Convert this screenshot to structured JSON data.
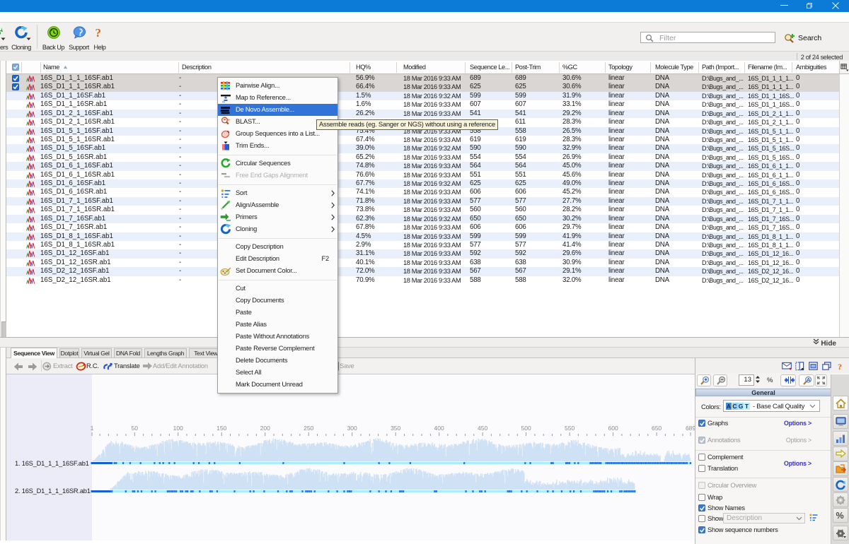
{
  "window": {
    "titlebar_color": "#0c7bd8",
    "controls": [
      "minimize",
      "restore",
      "close"
    ]
  },
  "toolbar": {
    "items": [
      {
        "id": "primers-partial",
        "label": "ers",
        "icon": "primers-icon",
        "dropdown": true
      },
      {
        "id": "cloning",
        "label": "Cloning",
        "icon": "cloning-icon",
        "dropdown": true
      },
      {
        "id": "backup",
        "label": "Back Up",
        "icon": "backup-icon"
      },
      {
        "id": "support",
        "label": "Support",
        "icon": "support-icon"
      },
      {
        "id": "help",
        "label": "Help",
        "icon": "help-icon"
      }
    ],
    "filter_placeholder": "Filter",
    "search_label": "Search"
  },
  "statusbar": {
    "selection": "2 of 24 selected"
  },
  "table": {
    "columns": [
      "Name",
      "Description",
      "HQ%",
      "Modified",
      "Sequence Le...",
      "Post-Trim",
      "%GC",
      "Topology",
      "Molecule Type",
      "Path (Import...",
      "Filename (Im...",
      "Ambiguities"
    ],
    "sort_column": "Name",
    "rows": [
      {
        "sel": true,
        "name": "16S_D1_1_1_16SF.ab1",
        "desc": "-",
        "hq": "56.9%",
        "mod": "18 Mar 2016 9:33 AM",
        "len": "689",
        "post": "689",
        "gc": "30.6%",
        "topo": "linear",
        "mol": "DNA",
        "path": "D:\\Bugs_and_...",
        "file": "16S_D1_1_1_1...",
        "amb": "0"
      },
      {
        "sel": true,
        "name": "16S_D1_1_1_16SR.ab1",
        "desc": "-",
        "hq": "66.4%",
        "mod": "18 Mar 2016 9:33 AM",
        "len": "625",
        "post": "625",
        "gc": "30.6%",
        "topo": "linear",
        "mol": "DNA",
        "path": "D:\\Bugs_and_...",
        "file": "16S_D1_1_1_1...",
        "amb": "0"
      },
      {
        "sel": false,
        "name": "16S_D1_1_16SF.ab1",
        "desc": "-",
        "hq": "1.5%",
        "mod": "18 Mar 2016 9:32 AM",
        "len": "599",
        "post": "599",
        "gc": "31.9%",
        "topo": "linear",
        "mol": "DNA",
        "path": "D:\\Bugs_and_...",
        "file": "16S_D1_1_16S...",
        "amb": "0"
      },
      {
        "sel": false,
        "name": "16S_D1_1_16SR.ab1",
        "desc": "-",
        "hq": "1.6%",
        "mod": "18 Mar 2016 9:33 AM",
        "len": "607",
        "post": "607",
        "gc": "33.1%",
        "topo": "linear",
        "mol": "DNA",
        "path": "D:\\Bugs_and_...",
        "file": "16S_D1_1_16S...",
        "amb": "0"
      },
      {
        "sel": false,
        "name": "16S_D1_2_1_16SF.ab1",
        "desc": "-",
        "hq": "26.2%",
        "mod": "18 Mar 2016 9:33 AM",
        "len": "541",
        "post": "541",
        "gc": "29.2%",
        "topo": "linear",
        "mol": "DNA",
        "path": "D:\\Bugs_and_...",
        "file": "16S_D1_2_1_1...",
        "amb": "0"
      },
      {
        "sel": false,
        "name": "16S_D1_2_1_16SR.ab1",
        "desc": "-",
        "hq": "",
        "mod": "",
        "len": "",
        "post": "611",
        "gc": "28.3%",
        "topo": "linear",
        "mol": "DNA",
        "path": "D:\\Bugs_and_...",
        "file": "16S_D1_2_1_1...",
        "amb": "0"
      },
      {
        "sel": false,
        "name": "16S_D1_5_1_16SF.ab1",
        "desc": "-",
        "hq": "75.4%",
        "mod": "18 Mar 2016 9:33 AM",
        "len": "558",
        "post": "558",
        "gc": "26.5%",
        "topo": "linear",
        "mol": "DNA",
        "path": "D:\\Bugs_and_...",
        "file": "16S_D1_5_1_1...",
        "amb": "0"
      },
      {
        "sel": false,
        "name": "16S_D1_5_1_16SR.ab1",
        "desc": "-",
        "hq": "67.4%",
        "mod": "18 Mar 2016 9:33 AM",
        "len": "619",
        "post": "619",
        "gc": "28.3%",
        "topo": "linear",
        "mol": "DNA",
        "path": "D:\\Bugs_and_...",
        "file": "16S_D1_5_1_1...",
        "amb": "0"
      },
      {
        "sel": false,
        "name": "16S_D1_5_16SF.ab1",
        "desc": "-",
        "hq": "39.0%",
        "mod": "18 Mar 2016 9:32 AM",
        "len": "590",
        "post": "590",
        "gc": "32.9%",
        "topo": "linear",
        "mol": "DNA",
        "path": "D:\\Bugs_and_...",
        "file": "16S_D1_5_16S...",
        "amb": "0"
      },
      {
        "sel": false,
        "name": "16S_D1_5_16SR.ab1",
        "desc": "-",
        "hq": "65.2%",
        "mod": "18 Mar 2016 9:33 AM",
        "len": "554",
        "post": "554",
        "gc": "26.9%",
        "topo": "linear",
        "mol": "DNA",
        "path": "D:\\Bugs_and_...",
        "file": "16S_D1_5_16S...",
        "amb": "0"
      },
      {
        "sel": false,
        "name": "16S_D1_6_1_16SF.ab1",
        "desc": "-",
        "hq": "74.8%",
        "mod": "18 Mar 2016 9:33 AM",
        "len": "564",
        "post": "564",
        "gc": "45.0%",
        "topo": "linear",
        "mol": "DNA",
        "path": "D:\\Bugs_and_...",
        "file": "16S_D1_6_1_1...",
        "amb": "0"
      },
      {
        "sel": false,
        "name": "16S_D1_6_1_16SR.ab1",
        "desc": "-",
        "hq": "76.6%",
        "mod": "18 Mar 2016 9:33 AM",
        "len": "551",
        "post": "551",
        "gc": "45.6%",
        "topo": "linear",
        "mol": "DNA",
        "path": "D:\\Bugs_and_...",
        "file": "16S_D1_6_1_1...",
        "amb": "0"
      },
      {
        "sel": false,
        "name": "16S_D1_6_16SF.ab1",
        "desc": "-",
        "hq": "67.7%",
        "mod": "18 Mar 2016 9:32 AM",
        "len": "625",
        "post": "625",
        "gc": "49.0%",
        "topo": "linear",
        "mol": "DNA",
        "path": "D:\\Bugs_and_...",
        "file": "16S_D1_6_16S...",
        "amb": "0"
      },
      {
        "sel": false,
        "name": "16S_D1_6_16SR.ab1",
        "desc": "-",
        "hq": "74.1%",
        "mod": "18 Mar 2016 9:33 AM",
        "len": "606",
        "post": "606",
        "gc": "45.2%",
        "topo": "linear",
        "mol": "DNA",
        "path": "D:\\Bugs_and_...",
        "file": "16S_D1_6_16S...",
        "amb": "0"
      },
      {
        "sel": false,
        "name": "16S_D1_7_1_16SF.ab1",
        "desc": "-",
        "hq": "71.8%",
        "mod": "18 Mar 2016 9:33 AM",
        "len": "577",
        "post": "577",
        "gc": "27.7%",
        "topo": "linear",
        "mol": "DNA",
        "path": "D:\\Bugs_and_...",
        "file": "16S_D1_7_1_1...",
        "amb": "0"
      },
      {
        "sel": false,
        "name": "16S_D1_7_1_16SR.ab1",
        "desc": "-",
        "hq": "73.8%",
        "mod": "18 Mar 2016 9:33 AM",
        "len": "560",
        "post": "560",
        "gc": "28.2%",
        "topo": "linear",
        "mol": "DNA",
        "path": "D:\\Bugs_and_...",
        "file": "16S_D1_7_1_1...",
        "amb": "0"
      },
      {
        "sel": false,
        "name": "16S_D1_7_16SF.ab1",
        "desc": "-",
        "hq": "62.3%",
        "mod": "18 Mar 2016 9:32 AM",
        "len": "650",
        "post": "650",
        "gc": "30.2%",
        "topo": "linear",
        "mol": "DNA",
        "path": "D:\\Bugs_and_...",
        "file": "16S_D1_7_16S...",
        "amb": "0"
      },
      {
        "sel": false,
        "name": "16S_D1_7_16SR.ab1",
        "desc": "-",
        "hq": "67.8%",
        "mod": "18 Mar 2016 9:33 AM",
        "len": "606",
        "post": "606",
        "gc": "29.7%",
        "topo": "linear",
        "mol": "DNA",
        "path": "D:\\Bugs_and_...",
        "file": "16S_D1_7_16S...",
        "amb": "0"
      },
      {
        "sel": false,
        "name": "16S_D1_8_1_16SF.ab1",
        "desc": "-",
        "hq": "4.5%",
        "mod": "18 Mar 2016 9:33 AM",
        "len": "599",
        "post": "599",
        "gc": "41.9%",
        "topo": "linear",
        "mol": "DNA",
        "path": "D:\\Bugs_and_...",
        "file": "16S_D1_8_1_1...",
        "amb": "0"
      },
      {
        "sel": false,
        "name": "16S_D1_8_1_16SR.ab1",
        "desc": "-",
        "hq": "2.9%",
        "mod": "18 Mar 2016 9:33 AM",
        "len": "577",
        "post": "577",
        "gc": "41.4%",
        "topo": "linear",
        "mol": "DNA",
        "path": "D:\\Bugs_and_...",
        "file": "16S_D1_8_1_1...",
        "amb": "0"
      },
      {
        "sel": false,
        "name": "16S_D1_12_16SF.ab1",
        "desc": "-",
        "hq": "31.1%",
        "mod": "18 Mar 2016 9:33 AM",
        "len": "592",
        "post": "592",
        "gc": "29.6%",
        "topo": "linear",
        "mol": "DNA",
        "path": "D:\\Bugs_and_...",
        "file": "16S_D1_12_16...",
        "amb": "0"
      },
      {
        "sel": false,
        "name": "16S_D1_12_16SR.ab1",
        "desc": "-",
        "hq": "40.1%",
        "mod": "18 Mar 2016 9:33 AM",
        "len": "638",
        "post": "638",
        "gc": "30.9%",
        "topo": "linear",
        "mol": "DNA",
        "path": "D:\\Bugs_and_...",
        "file": "16S_D1_12_16...",
        "amb": "0"
      },
      {
        "sel": false,
        "name": "16S_D2_12_16SF.ab1",
        "desc": "-",
        "hq": "72.0%",
        "mod": "18 Mar 2016 9:33 AM",
        "len": "567",
        "post": "567",
        "gc": "29.1%",
        "topo": "linear",
        "mol": "DNA",
        "path": "D:\\Bugs_and_...",
        "file": "16S_D2_12_16...",
        "amb": "0"
      },
      {
        "sel": false,
        "name": "16S_D2_12_16SR.ab1",
        "desc": "-",
        "hq": "70.9%",
        "mod": "18 Mar 2016 9:33 AM",
        "len": "588",
        "post": "588",
        "gc": "32.0%",
        "topo": "linear",
        "mol": "DNA",
        "path": "D:\\Bugs_and_...",
        "file": "16S_D2_12_16...",
        "amb": "0"
      }
    ]
  },
  "context_menu": {
    "items": [
      {
        "label": "Pairwise Align...",
        "icon": "pairwise-align-icon"
      },
      {
        "label": "Map to Reference...",
        "icon": "map-to-reference-icon"
      },
      {
        "label": "De Novo Assemble...",
        "icon": "de-novo-assemble-icon",
        "state": "highlighted"
      },
      {
        "label": "BLAST...",
        "icon": "blast-icon"
      },
      {
        "label": "Group Sequences into a List...",
        "icon": "group-sequences-icon"
      },
      {
        "label": "Trim Ends...",
        "icon": "trim-ends-icon"
      },
      {
        "separator": true
      },
      {
        "label": "Circular Sequences",
        "icon": "circular-sequences-icon"
      },
      {
        "label": "Free End Gaps Alignment",
        "icon": "free-end-gaps-icon",
        "state": "disabled"
      },
      {
        "separator": true
      },
      {
        "label": "Sort",
        "icon": "sort-icon",
        "submenu": true
      },
      {
        "label": "Align/Assemble",
        "icon": "align-assemble-icon",
        "submenu": true
      },
      {
        "label": "Primers",
        "icon": "primers-menu-icon",
        "submenu": true
      },
      {
        "label": "Cloning",
        "icon": "cloning-menu-icon",
        "submenu": true
      },
      {
        "separator": true
      },
      {
        "label": "Copy Description"
      },
      {
        "label": "Edit Description",
        "shortcut": "F2"
      },
      {
        "label": "Set Document Color...",
        "icon": "set-document-color-icon"
      },
      {
        "separator": true
      },
      {
        "label": "Cut"
      },
      {
        "label": "Copy Documents"
      },
      {
        "label": "Paste"
      },
      {
        "label": "Paste Alias"
      },
      {
        "label": "Paste Without Annotations"
      },
      {
        "label": "Paste Reverse Complement"
      },
      {
        "label": "Delete Documents"
      },
      {
        "label": "Select All"
      },
      {
        "label": "Mark Document Unread"
      }
    ]
  },
  "tooltip": {
    "text": "Assemble reads (eg. Sanger or NGS) without using a reference"
  },
  "bottom_panel": {
    "hide_label": "Hide",
    "tabs": [
      "Sequence View",
      "Dotplot",
      "Virtual Gel",
      "DNA Fold",
      "Lengths Graph",
      "Text View"
    ],
    "active_tab": "Sequence View",
    "toolbar": [
      {
        "id": "back",
        "icon": "back-arrow-icon"
      },
      {
        "id": "forward",
        "icon": "forward-arrow-icon"
      },
      {
        "id": "extract",
        "label": "Extract",
        "icon": "extract-icon",
        "disabled": true
      },
      {
        "id": "rc",
        "label": "R.C.",
        "icon": "reverse-complement-icon",
        "disabled": false
      },
      {
        "id": "translate",
        "label": "Translate",
        "icon": "translate-icon",
        "disabled": false
      },
      {
        "id": "annotation",
        "label": "Add/Edit Annotation",
        "icon": "annotation-icon",
        "disabled": true
      },
      {
        "id": "save",
        "label": "Save",
        "icon": "save-icon",
        "disabled": true
      }
    ]
  },
  "sequence_view": {
    "ruler_ticks": [
      1,
      50,
      100,
      150,
      200,
      250,
      300,
      350,
      400,
      450,
      500,
      550,
      600,
      650,
      689
    ],
    "rows": [
      {
        "label": "1. 16S_D1_1_1_16SF.ab1",
        "length": 689,
        "graph": {
          "seed": 11,
          "start": 2,
          "gap_from": 655,
          "gap_to": 659,
          "tail_to": 689
        },
        "dash_segments": [
          [
            1,
            24,
            1.0
          ],
          [
            24,
            85,
            0.3
          ],
          [
            85,
            160,
            0.14
          ],
          [
            160,
            280,
            0.07
          ],
          [
            280,
            420,
            0.05
          ],
          [
            420,
            545,
            0.08
          ],
          [
            545,
            575,
            0.5
          ],
          [
            575,
            610,
            0.8
          ],
          [
            610,
            689,
            0.97
          ]
        ]
      },
      {
        "label": "2. 16S_D1_1_1_16SR.ab1",
        "length": 625,
        "graph": {
          "seed": 23,
          "start": 22,
          "gap_from": -1,
          "gap_to": -1,
          "tail_to": 625
        },
        "dash_segments": [
          [
            1,
            23,
            1.0
          ],
          [
            23,
            100,
            0.28
          ],
          [
            100,
            240,
            0.18
          ],
          [
            240,
            350,
            0.24
          ],
          [
            350,
            470,
            0.14
          ],
          [
            470,
            575,
            0.28
          ],
          [
            575,
            612,
            0.6
          ],
          [
            612,
            625,
            0.97
          ]
        ]
      }
    ]
  },
  "side_panel": {
    "zoom": {
      "value": "13",
      "unit": "%"
    },
    "title": "General",
    "colors_label": "Colors:",
    "acgt": [
      "A",
      "C",
      "G",
      "T"
    ],
    "colors_value": "Base Call Quality",
    "options_label": "Options >",
    "rows": [
      {
        "label": "Graphs",
        "checked": true,
        "options": "active"
      },
      {
        "label": "Annotations",
        "checked": true,
        "disabled": true,
        "options": "disabled"
      },
      {
        "label": "Complement",
        "checked": false
      },
      {
        "label": "Translation",
        "checked": false,
        "options": "active"
      },
      {
        "label": "Circular Overview",
        "checked": false,
        "disabled": true
      },
      {
        "label": "Wrap",
        "checked": false
      },
      {
        "label": "Show Names",
        "checked": true
      },
      {
        "label": "Show",
        "checked": false,
        "dropdown": "Description"
      },
      {
        "label": "Show sequence numbers",
        "checked": true
      }
    ],
    "side_tabs": [
      "home-icon",
      "monitor-icon",
      "statistics-icon",
      "annotation-arrow-icon",
      "export-folder-icon",
      "refresh-icon",
      "gear-icon",
      "percent-icon",
      "advanced-gear-icon"
    ],
    "header_icons": [
      "envelope-icon",
      "dock-window-icon",
      "picture-window-icon",
      "new-window-icon",
      "help-question-icon"
    ]
  }
}
